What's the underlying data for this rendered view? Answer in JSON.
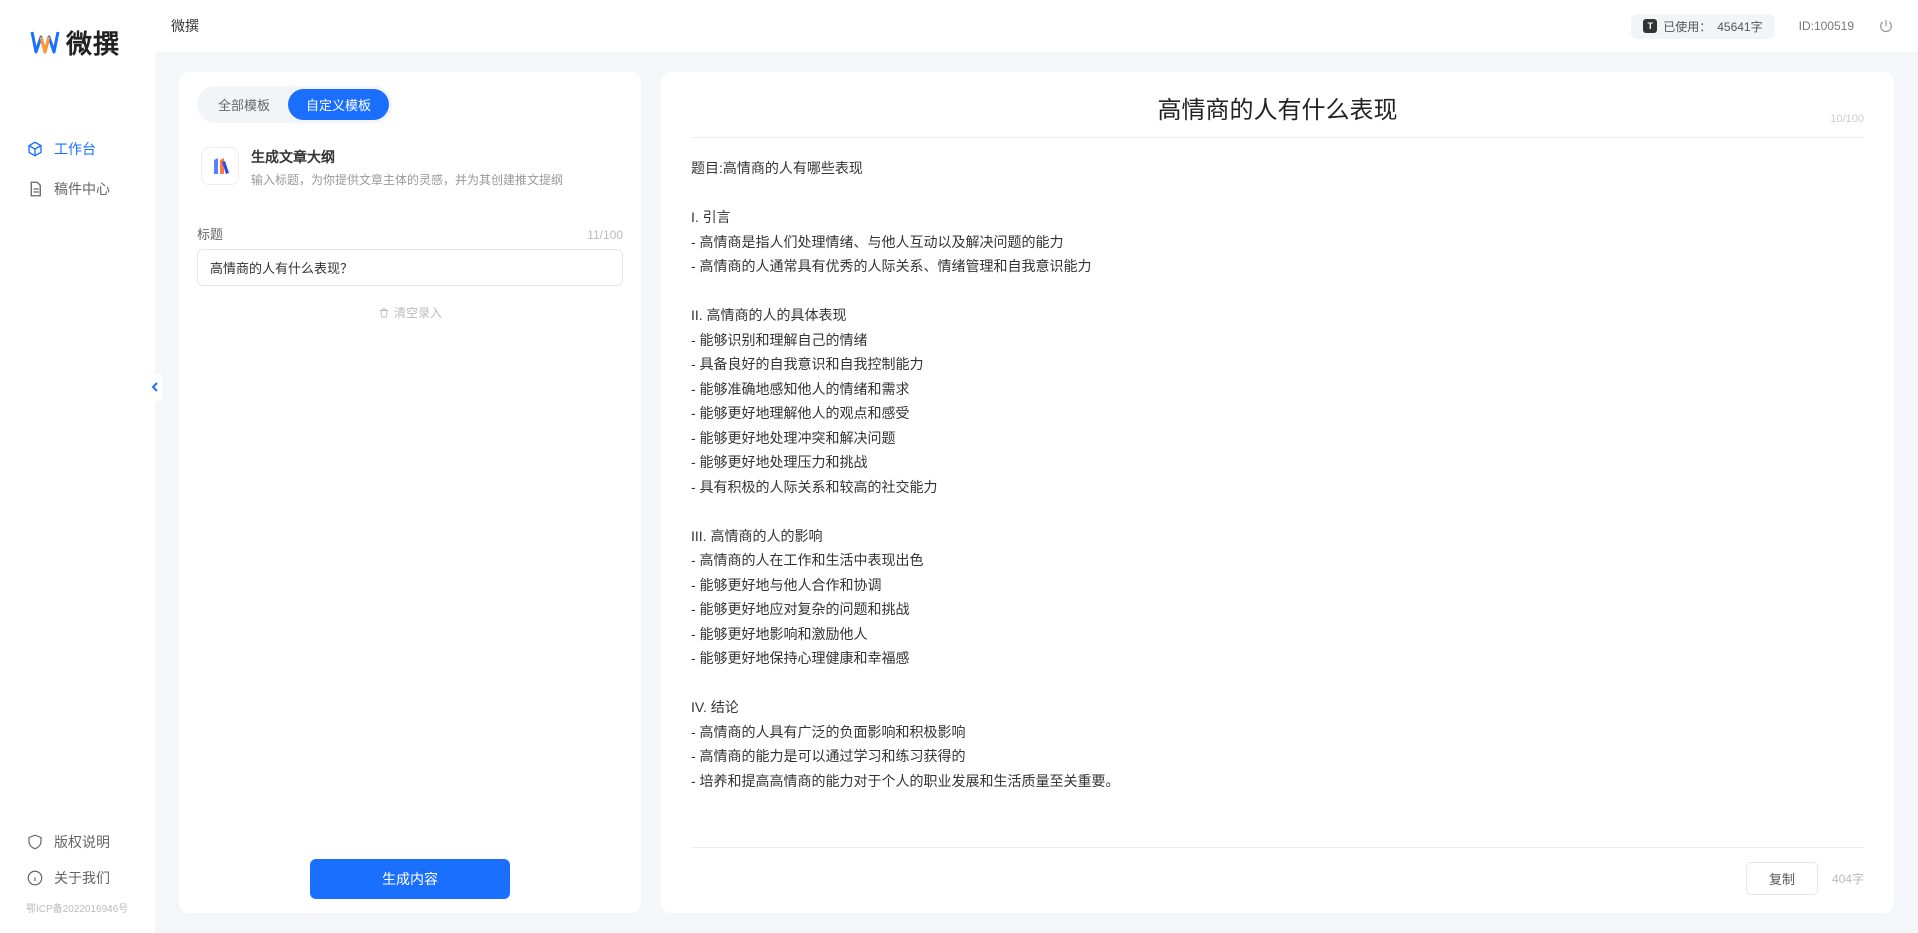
{
  "brand": {
    "name": "微撰"
  },
  "header": {
    "title": "微撰",
    "usage_label": "已使用：",
    "usage_value": "45641字",
    "id_label": "ID:",
    "id_value": "100519"
  },
  "sidebar": {
    "nav": [
      {
        "label": "工作台",
        "icon": "cube-icon",
        "active": true
      },
      {
        "label": "稿件中心",
        "icon": "doc-icon",
        "active": false
      }
    ],
    "footer": [
      {
        "label": "版权说明",
        "icon": "shield-icon"
      },
      {
        "label": "关于我们",
        "icon": "info-icon"
      }
    ],
    "icp": "鄂ICP备2022016946号"
  },
  "left": {
    "tabs": [
      {
        "label": "全部模板",
        "active": false
      },
      {
        "label": "自定义模板",
        "active": true
      }
    ],
    "template": {
      "title": "生成文章大纲",
      "desc": "输入标题，为你提供文章主体的灵感，并为其创建推文提纲"
    },
    "field_label": "标题",
    "field_count": "11/100",
    "title_value": "高情商的人有什么表现？",
    "clear_label": "清空录入",
    "generate_label": "生成内容"
  },
  "right": {
    "title": "高情商的人有什么表现",
    "title_count": "10/100",
    "body": "题目:高情商的人有哪些表现\n\nI. 引言\n- 高情商是指人们处理情绪、与他人互动以及解决问题的能力\n- 高情商的人通常具有优秀的人际关系、情绪管理和自我意识能力\n\nII. 高情商的人的具体表现\n- 能够识别和理解自己的情绪\n- 具备良好的自我意识和自我控制能力\n- 能够准确地感知他人的情绪和需求\n- 能够更好地理解他人的观点和感受\n- 能够更好地处理冲突和解决问题\n- 能够更好地处理压力和挑战\n- 具有积极的人际关系和较高的社交能力\n\nIII. 高情商的人的影响\n- 高情商的人在工作和生活中表现出色\n- 能够更好地与他人合作和协调\n- 能够更好地应对复杂的问题和挑战\n- 能够更好地影响和激励他人\n- 能够更好地保持心理健康和幸福感\n\nIV. 结论\n- 高情商的人具有广泛的负面影响和积极影响\n- 高情商的能力是可以通过学习和练习获得的\n- 培养和提高高情商的能力对于个人的职业发展和生活质量至关重要。",
    "copy_label": "复制",
    "word_count": "404字"
  }
}
